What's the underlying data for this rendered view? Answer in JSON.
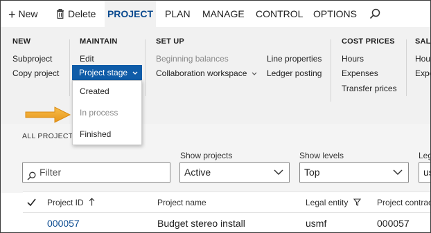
{
  "action_bar": {
    "new_label": "New",
    "delete_label": "Delete",
    "tabs": [
      "PROJECT",
      "PLAN",
      "MANAGE",
      "CONTROL",
      "OPTIONS"
    ],
    "active_tab": "PROJECT",
    "search_icon": "search-icon"
  },
  "ribbon": {
    "new": {
      "title": "NEW",
      "items": [
        "Subproject",
        "Copy project"
      ]
    },
    "maintain": {
      "title": "MAINTAIN",
      "items": [
        "Edit"
      ],
      "stage_button": "Project stage"
    },
    "setup": {
      "title": "SET UP",
      "items": [
        "Beginning balances",
        "Collaboration workspace",
        "Line properties",
        "Ledger posting"
      ]
    },
    "cost_prices": {
      "title": "COST PRICES",
      "items": [
        "Hours",
        "Expenses",
        "Transfer prices"
      ]
    },
    "sales": {
      "title": "SALE",
      "items": [
        "Hour",
        "Expe"
      ]
    }
  },
  "stage_dropdown": {
    "options": [
      "Created",
      "In process",
      "Finished"
    ],
    "disabled_option": "In process"
  },
  "filters": {
    "section_title": "ALL PROJECTS",
    "filter_placeholder": "Filter",
    "show_projects_label": "Show projects",
    "show_projects_value": "Active",
    "show_levels_label": "Show levels",
    "show_levels_value": "Top",
    "legal_label": "Leg",
    "legal_value": "us"
  },
  "grid": {
    "columns": [
      "Project ID",
      "Project name",
      "Legal entity",
      "Project contract"
    ],
    "rows": [
      {
        "project_id": "000057",
        "project_name": "Budget stereo install",
        "legal_entity": "usmf",
        "project_contract": "000057"
      }
    ]
  },
  "colors": {
    "accent": "#0f5ca8",
    "active_tab_text": "#0a4a8f",
    "ribbon_bg": "#f1f1f1",
    "callout_arrow": "#f2a92b"
  }
}
